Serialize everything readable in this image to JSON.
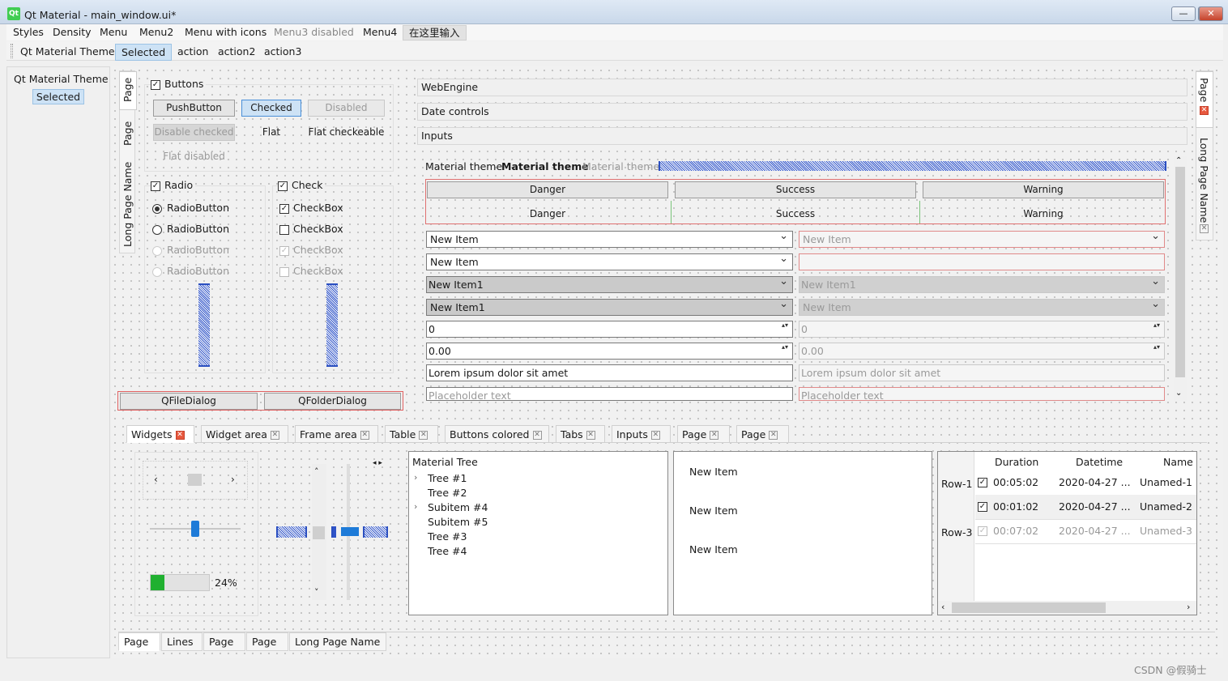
{
  "window": {
    "title": "Qt Material - main_window.ui*",
    "logo": "Qt",
    "min": "—",
    "max": "□",
    "close": "✕"
  },
  "menu": [
    "Styles",
    "Density",
    "Menu",
    "Menu2",
    "Menu with icons",
    "Menu3 disabled",
    "Menu4",
    "在这里输入"
  ],
  "toolbar": [
    "Qt Material Theme",
    "Selected",
    "action",
    "action2",
    "action3"
  ],
  "dock": {
    "title": "Qt Material Theme",
    "selected": "Selected"
  },
  "left_vtabs": [
    "Page",
    "Page",
    "Long Page Name"
  ],
  "buttons": {
    "group": "Buttons",
    "push": "PushButton",
    "checked": "Checked",
    "disabled": "Disabled",
    "disable_checked": "Disable checked",
    "flat": "Flat",
    "flat_checkable": "Flat checkeable",
    "flat_disabled": "Flat disabled"
  },
  "radio": {
    "group": "Radio",
    "items": [
      "RadioButton",
      "RadioButton",
      "RadioButton",
      "RadioButton"
    ]
  },
  "check": {
    "group": "Check",
    "items": [
      "CheckBox",
      "CheckBox",
      "CheckBox",
      "CheckBox"
    ]
  },
  "dialogs": {
    "file": "QFileDialog",
    "folder": "QFolderDialog"
  },
  "accordion": [
    "WebEngine",
    "Date controls",
    "Inputs"
  ],
  "labels": {
    "normal": "Material theme",
    "bold": "Material theme",
    "light": "Material theme"
  },
  "colored": {
    "row1": [
      "Danger",
      "Success",
      "Warning"
    ],
    "row2": [
      "Danger",
      "Success",
      "Warning"
    ]
  },
  "inputs": {
    "combo1": "New Item",
    "combo1d": "New Item",
    "combo2": "New Item",
    "combo3": "New Item1",
    "combo3d": "New Item1",
    "combo4": "New Item1",
    "combo4d": "New Item",
    "spin": "0",
    "spind": "0",
    "dspin": "0.00",
    "dspind": "0.00",
    "line": "Lorem ipsum dolor sit amet",
    "lined": "Lorem ipsum dolor sit amet",
    "placeholder": "Placeholder text",
    "placeholderd": "Placeholder text"
  },
  "right_vtabs": [
    "Page",
    "Long Page Name"
  ],
  "tabs": [
    "Widgets",
    "Widget area",
    "Frame area",
    "Table",
    "Buttons colored",
    "Tabs",
    "Inputs",
    "Page",
    "Page"
  ],
  "progress": {
    "value": 24,
    "label": "24%"
  },
  "tree": {
    "header": "Material Tree",
    "items": [
      {
        "t": "Tree #1",
        "exp": true
      },
      {
        "t": "Tree #2",
        "exp": false
      },
      {
        "t": "Subitem #4",
        "exp": true
      },
      {
        "t": "Subitem #5",
        "exp": false
      },
      {
        "t": "Tree #3",
        "exp": false
      },
      {
        "t": "Tree #4",
        "exp": false
      }
    ]
  },
  "list": [
    "New Item",
    "New Item",
    "New Item"
  ],
  "table": {
    "headers": [
      "Duration",
      "Datetime",
      "Name"
    ],
    "rows": [
      {
        "h": "Row-1",
        "d": "00:05:02",
        "dt": "2020-04-27 ...",
        "n": "Unamed-1"
      },
      {
        "h": "",
        "d": "00:01:02",
        "dt": "2020-04-27 ...",
        "n": "Unamed-2"
      },
      {
        "h": "Row-3",
        "d": "00:07:02",
        "dt": "2020-04-27 ...",
        "n": "Unamed-3"
      }
    ]
  },
  "bottom_tabs": [
    "Page",
    "Lines",
    "Page",
    "Page",
    "Long Page Name"
  ],
  "watermark": "CSDN @假骑士"
}
